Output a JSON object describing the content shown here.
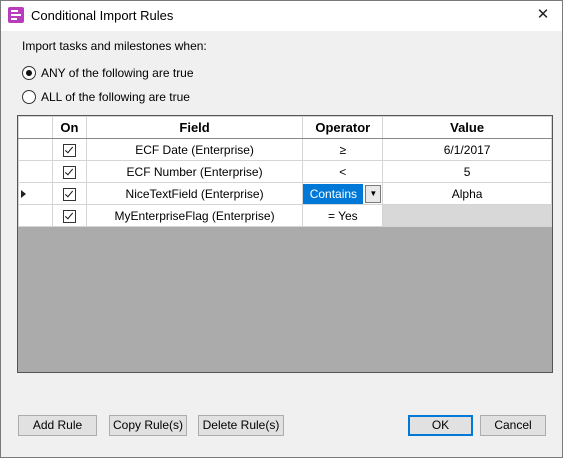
{
  "window": {
    "title": "Conditional Import Rules",
    "close_glyph": "✕"
  },
  "prompt": "Import tasks and milestones when:",
  "match_mode": {
    "options": [
      {
        "label": "ANY of the following are true",
        "selected": true
      },
      {
        "label": "ALL of the following are true",
        "selected": false
      }
    ]
  },
  "grid": {
    "headers": {
      "on": "On",
      "field": "Field",
      "operator": "Operator",
      "value": "Value"
    },
    "rows": [
      {
        "on": true,
        "field": "ECF Date (Enterprise)",
        "operator": "≥",
        "value": "6/1/2017"
      },
      {
        "on": true,
        "field": "ECF Number (Enterprise)",
        "operator": "<",
        "value": "5"
      },
      {
        "on": true,
        "field": "NiceTextField (Enterprise)",
        "operator": "Contains",
        "value": "Alpha",
        "current": true
      },
      {
        "on": true,
        "field": "MyEnterpriseFlag (Enterprise)",
        "operator": "= Yes",
        "value": ""
      }
    ]
  },
  "buttons": {
    "add_rule": "Add Rule",
    "copy_rules": "Copy Rule(s)",
    "delete_rules": "Delete Rule(s)",
    "ok": "OK",
    "cancel": "Cancel"
  },
  "colors": {
    "selection": "#0078d7",
    "app_icon": "#b83cbe",
    "grid_empty": "#ababab"
  }
}
